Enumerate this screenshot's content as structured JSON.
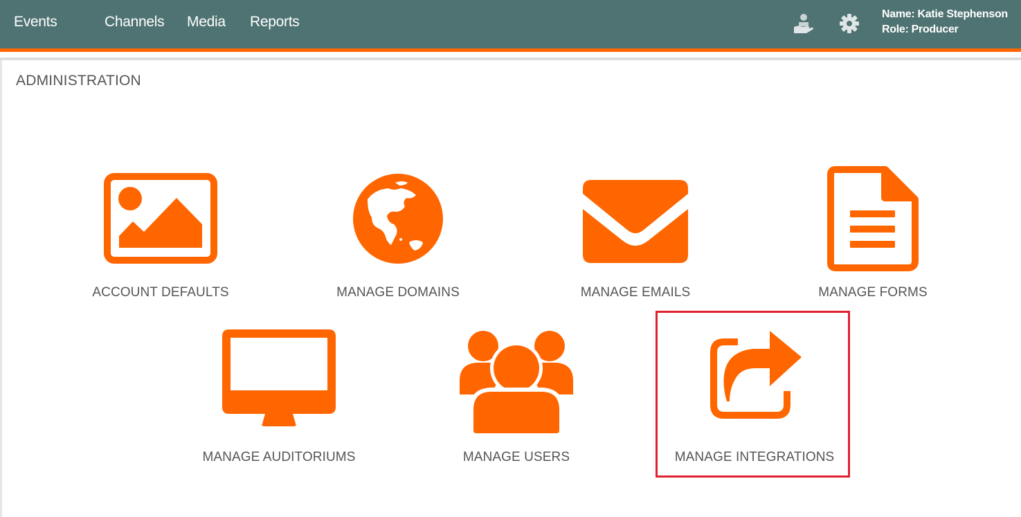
{
  "nav": {
    "items": [
      {
        "label": "Events"
      },
      {
        "label": "Channels"
      },
      {
        "label": "Media"
      },
      {
        "label": "Reports"
      }
    ]
  },
  "header": {
    "icons": [
      "support-hand-icon",
      "gear-icon"
    ],
    "user_name": "Name: Katie Stephenson",
    "user_role": "Role: Producer"
  },
  "page": {
    "title": "ADMINISTRATION"
  },
  "tiles": [
    {
      "label": "ACCOUNT DEFAULTS",
      "icon": "image-icon"
    },
    {
      "label": "MANAGE DOMAINS",
      "icon": "globe-icon"
    },
    {
      "label": "MANAGE EMAILS",
      "icon": "envelope-icon"
    },
    {
      "label": "MANAGE FORMS",
      "icon": "document-icon"
    },
    {
      "label": "MANAGE AUDITORIUMS",
      "icon": "monitor-icon"
    },
    {
      "label": "MANAGE USERS",
      "icon": "users-icon"
    },
    {
      "label": "MANAGE INTEGRATIONS",
      "icon": "share-icon"
    }
  ],
  "colors": {
    "header_bg": "#4f7372",
    "accent": "#ff6600",
    "highlight_border": "#e0202e",
    "label_text": "#555555"
  }
}
